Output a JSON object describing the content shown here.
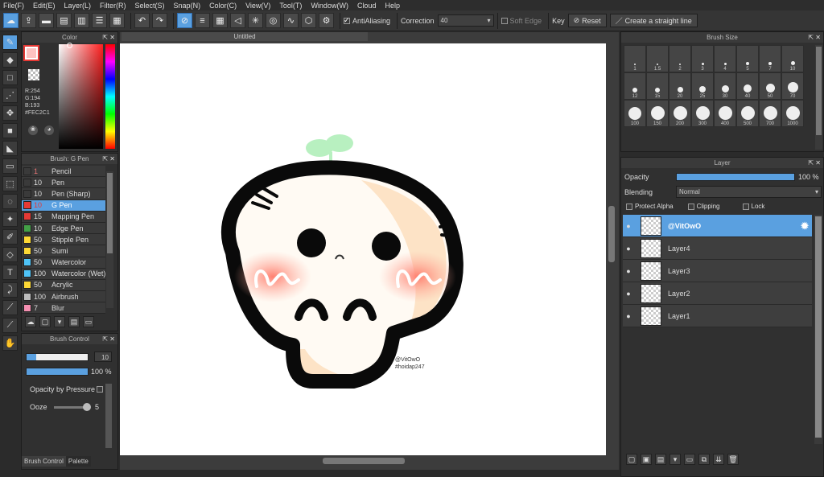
{
  "menu": [
    "File(F)",
    "Edit(E)",
    "Layer(L)",
    "Filter(R)",
    "Select(S)",
    "Snap(N)",
    "Color(C)",
    "View(V)",
    "Tool(T)",
    "Window(W)",
    "Cloud",
    "Help"
  ],
  "toolbar": {
    "antialiasing_label": "AntiAliasing",
    "correction_label": "Correction",
    "correction_value": "40",
    "soft_edge_label": "Soft Edge",
    "key_label": "Key",
    "reset_label": "Reset",
    "straight_line_label": "Create a straight line"
  },
  "color_panel": {
    "title": "Color",
    "r": "R:254",
    "g": "G:194",
    "b": "B:193",
    "hex": "#FEC2C1",
    "current_color": "#fec2c1"
  },
  "brush_panel": {
    "title": "Brush: G Pen",
    "items": [
      {
        "color": "#3a3a3a",
        "size": "1",
        "name": "Pencil"
      },
      {
        "color": "#3a3a3a",
        "size": "10",
        "name": "Pen"
      },
      {
        "color": "#3a3a3a",
        "size": "10",
        "name": "Pen (Sharp)"
      },
      {
        "color": "#e53935",
        "size": "10",
        "name": "G Pen"
      },
      {
        "color": "#e53935",
        "size": "15",
        "name": "Mapping Pen"
      },
      {
        "color": "#43a047",
        "size": "10",
        "name": "Edge Pen"
      },
      {
        "color": "#fdd835",
        "size": "50",
        "name": "Stipple Pen"
      },
      {
        "color": "#fdd835",
        "size": "50",
        "name": "Sumi"
      },
      {
        "color": "#4fc3f7",
        "size": "50",
        "name": "Watercolor"
      },
      {
        "color": "#4fc3f7",
        "size": "100",
        "name": "Watercolor (Wet)"
      },
      {
        "color": "#fdd835",
        "size": "50",
        "name": "Acrylic"
      },
      {
        "color": "#bdbdbd",
        "size": "100",
        "name": "Airbrush"
      },
      {
        "color": "#f48fb1",
        "size": "7",
        "name": "Blur"
      }
    ]
  },
  "brush_control": {
    "title": "Brush Control",
    "size_value": "10",
    "opacity_value": "100 %",
    "opacity_by_pressure_label": "Opacity by Pressure",
    "ooze_label": "Ooze",
    "ooze_value": "5",
    "tab_brush_control": "Brush Control",
    "tab_palette": "Palette"
  },
  "canvas": {
    "tab_title": "Untitled",
    "watermark_line1": "@VitOwO",
    "watermark_line2": "#hoidap247"
  },
  "brush_size_panel": {
    "title": "Brush Size",
    "sizes": [
      "1",
      "1.5",
      "2",
      "3",
      "4",
      "5",
      "7",
      "10",
      "12",
      "15",
      "20",
      "25",
      "30",
      "40",
      "50",
      "70",
      "100",
      "150",
      "200",
      "300",
      "400",
      "500",
      "700",
      "1000"
    ]
  },
  "layer_panel": {
    "title": "Layer",
    "opacity_label": "Opacity",
    "opacity_value": "100 %",
    "blending_label": "Blending",
    "blending_value": "Normal",
    "protect_alpha_label": "Protect Alpha",
    "clipping_label": "Clipping",
    "lock_label": "Lock",
    "layers": [
      "@VitOwO",
      "Layer4",
      "Layer3",
      "Layer2",
      "Layer1"
    ]
  }
}
